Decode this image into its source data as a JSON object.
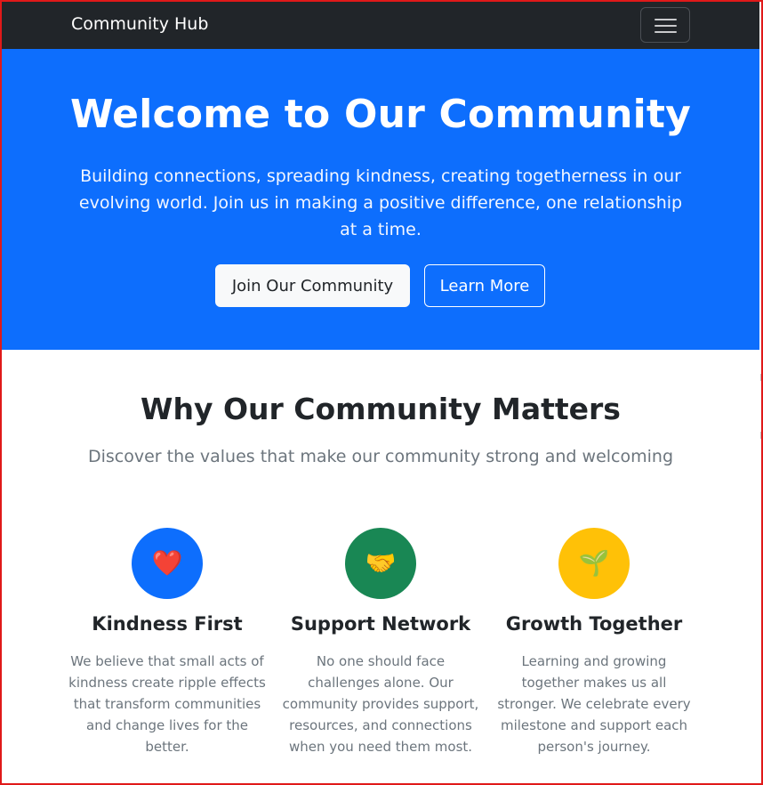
{
  "navbar": {
    "brand": "Community Hub",
    "toggler_icon": "hamburger-menu-icon"
  },
  "hero": {
    "title": "Welcome to Our Community",
    "subtitle": "Building connections, spreading kindness, creating togetherness in our evolving world. Join us in making a positive difference, one relationship at a time.",
    "primary_button": "Join Our Community",
    "secondary_button": "Learn More",
    "background_color": "#0d6efd"
  },
  "section": {
    "title": "Why Our Community Matters",
    "subtitle": "Discover the values that make our community strong and welcoming"
  },
  "features": [
    {
      "icon": "heart-icon",
      "glyph": "❤️",
      "circle_color": "#0d6efd",
      "title": "Kindness First",
      "text": "We believe that small acts of kindness create ripple effects that transform communities and change lives for the better."
    },
    {
      "icon": "handshake-icon",
      "glyph": "🤝",
      "circle_color": "#198754",
      "title": "Support Network",
      "text": "No one should face challenges alone. Our community provides support, resources, and connections when you need them most."
    },
    {
      "icon": "seedling-icon",
      "glyph": "🌱",
      "circle_color": "#ffc107",
      "title": "Growth Together",
      "text": "Learning and growing together makes us all stronger. We celebrate every milestone and support each person's journey."
    }
  ]
}
